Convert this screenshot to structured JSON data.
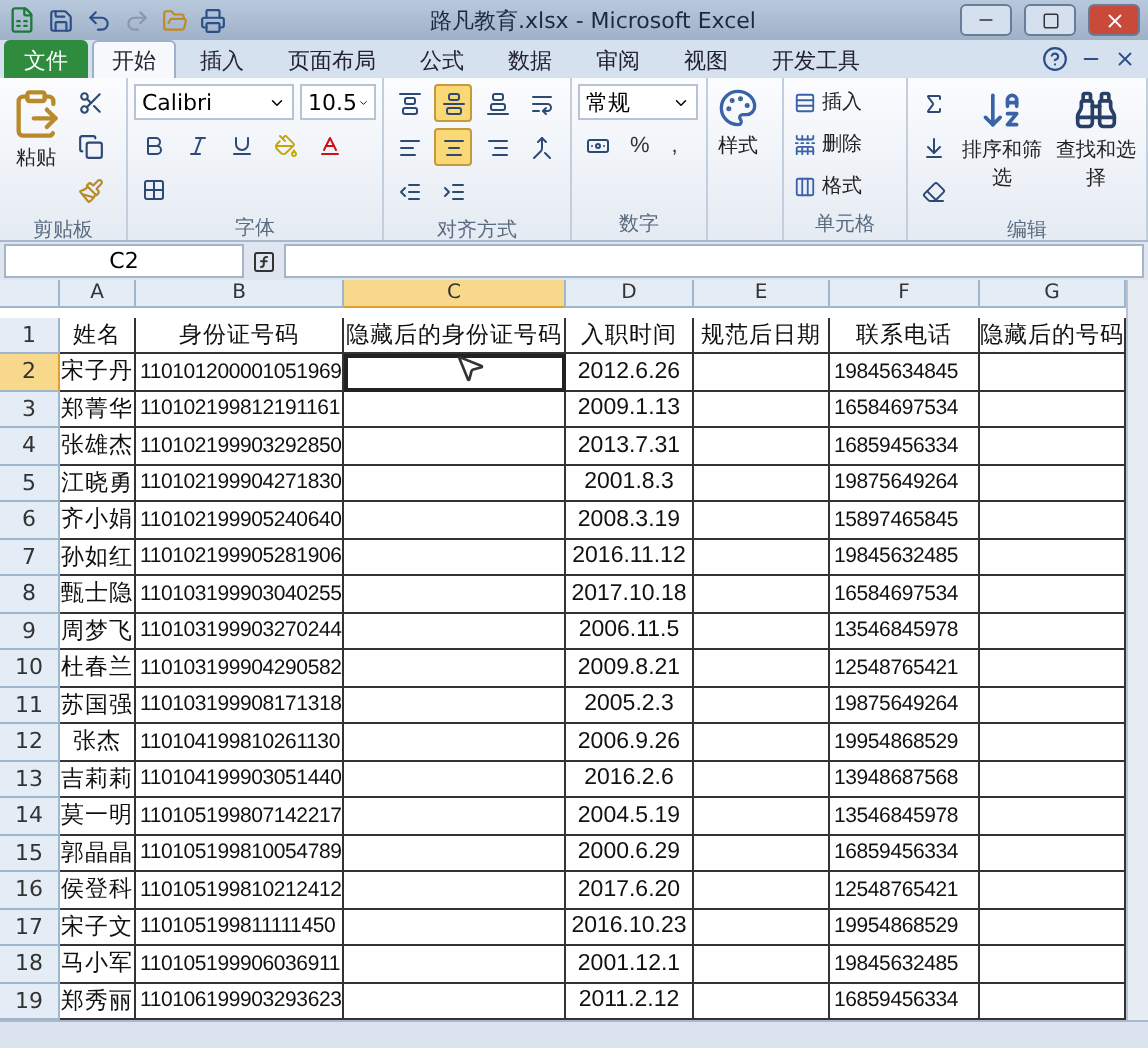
{
  "window": {
    "title": "路凡教育.xlsx - Microsoft Excel"
  },
  "tabs": [
    {
      "label": "文件",
      "kind": "file",
      "selected": false
    },
    {
      "label": "开始",
      "kind": "tab",
      "selected": true
    },
    {
      "label": "插入",
      "kind": "tab",
      "selected": false
    },
    {
      "label": "页面布局",
      "kind": "tab",
      "selected": false
    },
    {
      "label": "公式",
      "kind": "tab",
      "selected": false
    },
    {
      "label": "数据",
      "kind": "tab",
      "selected": false
    },
    {
      "label": "审阅",
      "kind": "tab",
      "selected": false
    },
    {
      "label": "视图",
      "kind": "tab",
      "selected": false
    },
    {
      "label": "开发工具",
      "kind": "tab",
      "selected": false
    }
  ],
  "ribbon": {
    "clipboard": {
      "label": "剪贴板",
      "paste": "粘贴"
    },
    "font": {
      "label": "字体",
      "name": "Calibri",
      "size": "10.5"
    },
    "alignment": {
      "label": "对齐方式",
      "buttons": [
        {
          "selected": false
        },
        {
          "selected": true
        },
        {
          "selected": false
        },
        {
          "selected": false
        },
        {
          "selected": true
        },
        {
          "selected": false
        }
      ]
    },
    "number": {
      "label": "数字",
      "format": "常规",
      "percent": "%",
      "comma": ","
    },
    "styles": {
      "button": "样式"
    },
    "cells": {
      "label": "单元格",
      "buttons": [
        "插入",
        "删除",
        "格式"
      ]
    },
    "editing": {
      "label": "编辑",
      "buttons": [
        "排序和筛选",
        "查找和选择"
      ]
    }
  },
  "name_box": "C2",
  "columns": [
    {
      "letter": "A",
      "selected": false
    },
    {
      "letter": "B",
      "selected": false
    },
    {
      "letter": "C",
      "selected": true
    },
    {
      "letter": "D",
      "selected": false
    },
    {
      "letter": "E",
      "selected": false
    },
    {
      "letter": "F",
      "selected": false
    },
    {
      "letter": "G",
      "selected": false
    }
  ],
  "header_row": {
    "number": "1",
    "selected": false,
    "cells": [
      "姓名",
      "身份证号码",
      "隐藏后的身份证号码",
      "入职时间",
      "规范后日期",
      "联系电话",
      "隐藏后的号码"
    ]
  },
  "rows": [
    {
      "number": "2",
      "selected": true,
      "name": "宋子丹",
      "id": "110101200001051969",
      "date": "2012.6.26",
      "phone": "19845634845"
    },
    {
      "number": "3",
      "selected": false,
      "name": "郑菁华",
      "id": "110102199812191161",
      "date": "2009.1.13",
      "phone": "16584697534"
    },
    {
      "number": "4",
      "selected": false,
      "name": "张雄杰",
      "id": "110102199903292850",
      "date": "2013.7.31",
      "phone": "16859456334"
    },
    {
      "number": "5",
      "selected": false,
      "name": "江晓勇",
      "id": "110102199904271830",
      "date": "2001.8.3",
      "phone": "19875649264"
    },
    {
      "number": "6",
      "selected": false,
      "name": "齐小娟",
      "id": "110102199905240640",
      "date": "2008.3.19",
      "phone": "15897465845"
    },
    {
      "number": "7",
      "selected": false,
      "name": "孙如红",
      "id": "110102199905281906",
      "date": "2016.11.12",
      "phone": "19845632485"
    },
    {
      "number": "8",
      "selected": false,
      "name": "甄士隐",
      "id": "110103199903040255",
      "date": "2017.10.18",
      "phone": "16584697534"
    },
    {
      "number": "9",
      "selected": false,
      "name": "周梦飞",
      "id": "110103199903270244",
      "date": "2006.11.5",
      "phone": "13546845978"
    },
    {
      "number": "10",
      "selected": false,
      "name": "杜春兰",
      "id": "110103199904290582",
      "date": "2009.8.21",
      "phone": "12548765421"
    },
    {
      "number": "11",
      "selected": false,
      "name": "苏国强",
      "id": "110103199908171318",
      "date": "2005.2.3",
      "phone": "19875649264"
    },
    {
      "number": "12",
      "selected": false,
      "name": "张杰",
      "id": "110104199810261130",
      "date": "2006.9.26",
      "phone": "19954868529"
    },
    {
      "number": "13",
      "selected": false,
      "name": "吉莉莉",
      "id": "110104199903051440",
      "date": "2016.2.6",
      "phone": "13948687568"
    },
    {
      "number": "14",
      "selected": false,
      "name": "莫一明",
      "id": "110105199807142217",
      "date": "2004.5.19",
      "phone": "13546845978"
    },
    {
      "number": "15",
      "selected": false,
      "name": "郭晶晶",
      "id": "110105199810054789",
      "date": "2000.6.29",
      "phone": "16859456334"
    },
    {
      "number": "16",
      "selected": false,
      "name": "侯登科",
      "id": "110105199810212412",
      "date": "2017.6.20",
      "phone": "12548765421"
    },
    {
      "number": "17",
      "selected": false,
      "name": "宋子文",
      "id": "110105199811111450",
      "date": "2016.10.23",
      "phone": "19954868529"
    },
    {
      "number": "18",
      "selected": false,
      "name": "马小军",
      "id": "110105199906036911",
      "date": "2001.12.1",
      "phone": "19845632485"
    },
    {
      "number": "19",
      "selected": false,
      "name": "郑秀丽",
      "id": "110106199903293623",
      "date": "2011.2.12",
      "phone": "16859456334"
    }
  ]
}
